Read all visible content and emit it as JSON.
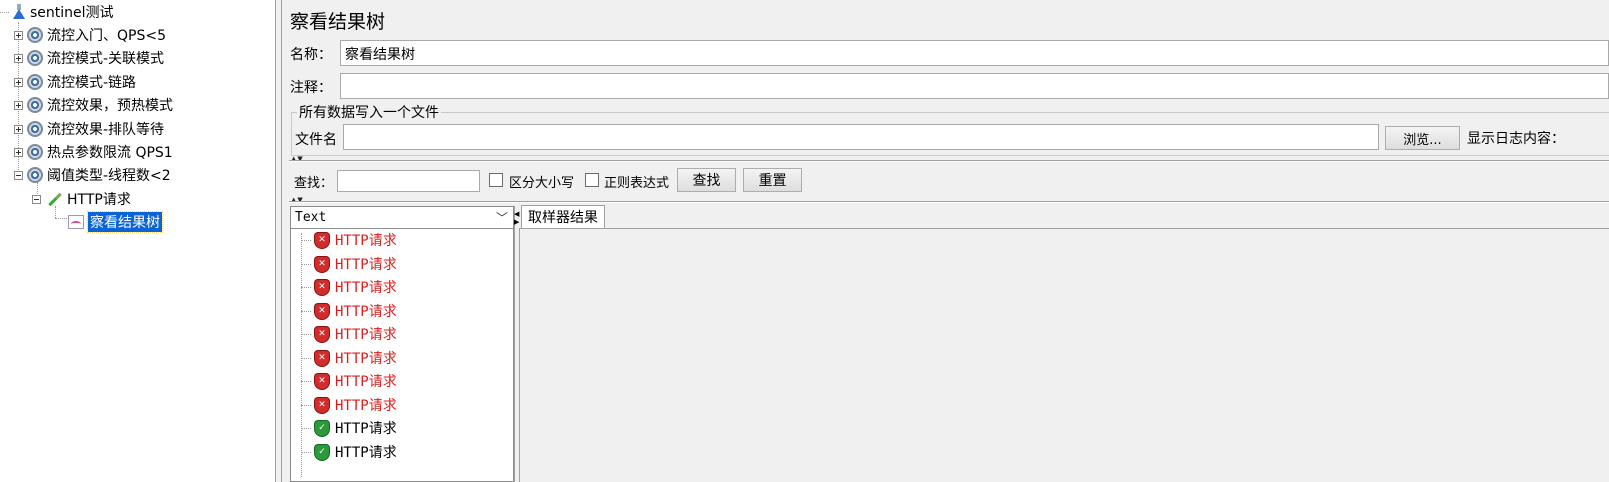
{
  "test_plan": {
    "root": {
      "label": "sentinel测试",
      "icon": "flask-icon"
    },
    "groups": [
      {
        "label": "流控入门、QPS<5",
        "icon": "gear-icon",
        "expanded": false
      },
      {
        "label": "流控模式-关联模式",
        "icon": "gear-icon",
        "expanded": false
      },
      {
        "label": "流控模式-链路",
        "icon": "gear-icon",
        "expanded": false
      },
      {
        "label": "流控效果，预热模式",
        "icon": "gear-icon",
        "expanded": false
      },
      {
        "label": "流控效果-排队等待",
        "icon": "gear-icon",
        "expanded": false
      },
      {
        "label": "热点参数限流 QPS1",
        "icon": "gear-icon",
        "expanded": false
      },
      {
        "label": "阈值类型-线程数<2",
        "icon": "gear-icon",
        "expanded": true
      }
    ],
    "sampler": {
      "label": "HTTP请求",
      "icon": "pipette-icon"
    },
    "listener": {
      "label": "察看结果树",
      "icon": "graph-icon",
      "selected": true
    }
  },
  "panel": {
    "title": "察看结果树",
    "name_label": "名称：",
    "name_value": "察看结果树",
    "comment_label": "注释：",
    "comment_value": "",
    "file_group_title": "所有数据写入一个文件",
    "filename_label": "文件名",
    "filename_value": "",
    "browse_button": "浏览...",
    "log_display_label": "显示日志内容："
  },
  "search": {
    "label": "查找：",
    "value": "",
    "case_sensitive_label": "区分大小写",
    "case_sensitive_checked": false,
    "regex_label": "正则表达式",
    "regex_checked": false,
    "find_button": "查找",
    "reset_button": "重置"
  },
  "results": {
    "renderer": "Text",
    "items": [
      {
        "label": "HTTP请求",
        "status": "fail"
      },
      {
        "label": "HTTP请求",
        "status": "fail"
      },
      {
        "label": "HTTP请求",
        "status": "fail"
      },
      {
        "label": "HTTP请求",
        "status": "fail"
      },
      {
        "label": "HTTP请求",
        "status": "fail"
      },
      {
        "label": "HTTP请求",
        "status": "fail"
      },
      {
        "label": "HTTP请求",
        "status": "fail"
      },
      {
        "label": "HTTP请求",
        "status": "fail"
      },
      {
        "label": "HTTP请求",
        "status": "pass"
      },
      {
        "label": "HTTP请求",
        "status": "pass"
      }
    ]
  },
  "detail": {
    "tab_label": "取样器结果"
  },
  "colors": {
    "fail_text": "#e01b1b",
    "selection": "#0a64d8"
  }
}
